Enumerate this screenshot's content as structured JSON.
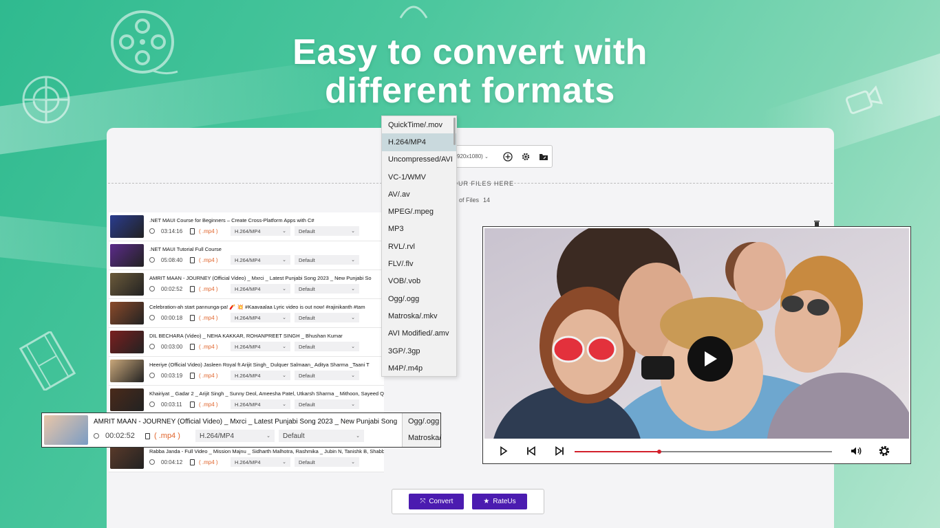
{
  "headline": {
    "line1": "Easy to convert with",
    "line2": "different formats"
  },
  "toolbar": {
    "resolution_label": "920x1080)",
    "add_icon": "plus-circle-icon",
    "settings_icon": "gear-icon",
    "folder_icon": "folder-icon"
  },
  "dropzone": {
    "label": "OUR FILES HERE",
    "files_label": "of Files",
    "files_count": "14"
  },
  "files": [
    {
      "title": ".NET MAUI Course for Beginners – Create Cross-Platform Apps with C#",
      "duration": "03:14:16",
      "ext": "( .mp4 )",
      "format": "H.264/MP4",
      "preset": "Default",
      "thumb_color": "#2a3c8f"
    },
    {
      "title": ".NET MAUI Tutorial Full Course",
      "duration": "05:08:40",
      "ext": "( .mp4 )",
      "format": "H.264/MP4",
      "preset": "Default",
      "thumb_color": "#5b2b8a"
    },
    {
      "title": "AMRIT MAAN - JOURNEY (Official Video) _ Mxrci _ Latest Punjabi Song 2023 _ New Punjabi So",
      "duration": "00:02:52",
      "ext": "( .mp4 )",
      "format": "H.264/MP4",
      "preset": "Default",
      "thumb_color": "#6b5a3a"
    },
    {
      "title": "Celebration-ah start pannunga-pa! 🧨 💥 #Kaavaalaa Lyric video is out now! #rajinikanth #tam",
      "duration": "00:00:18",
      "ext": "( .mp4 )",
      "format": "H.264/MP4",
      "preset": "Default",
      "thumb_color": "#8a4a2a"
    },
    {
      "title": "DIL BECHARA (Video) _ NEHA KAKKAR, ROHANPREET SINGH _ Bhushan Kumar",
      "duration": "00:03:00",
      "ext": "( .mp4 )",
      "format": "H.264/MP4",
      "preset": "Default",
      "thumb_color": "#7a1f1f"
    },
    {
      "title": "Heeriye (Official Video) Jasleen Royal ft Arijit Singh_ Dulquer Salmaan_ Aditya Sharma _Taani T",
      "duration": "00:03:19",
      "ext": "( .mp4 )",
      "format": "H.264/MP4",
      "preset": "Default",
      "thumb_color": "#c9a77a"
    },
    {
      "title": "Khairiyat _ Gadar 2 _ Arijit Singh _ Sunny Deol, Ameesha Patel, Utkarsh Sharma _ Mithoon, Sayeed Q",
      "duration": "00:03:11",
      "ext": "( .mp4 )",
      "format": "H.264/MP4",
      "preset": "Default",
      "thumb_color": "#4a2a1a"
    },
    {
      "title": "",
      "duration": "",
      "ext": "",
      "format": "",
      "preset": "",
      "thumb_color": "#888"
    },
    {
      "title": "Rabba Janda - Full Video _ Mission Majnu _ Sidharth Malhotra, Rashmika _ Jubin N, Tanishk B, Shabbir",
      "duration": "00:04:12",
      "ext": "( .mp4 )",
      "format": "H.264/MP4",
      "preset": "Default",
      "thumb_color": "#5a3a2a"
    }
  ],
  "formats": [
    "QuickTime/.mov",
    "H.264/MP4",
    "Uncompressed/AVI",
    "VC-1/WMV",
    "AV/.av",
    "MPEG/.mpeg",
    "MP3",
    "RVL/.rvl",
    "FLV/.flv",
    "VOB/.vob",
    "Ogg/.ogg",
    "Matroska/.mkv",
    "AVI Modified/.amv",
    "3GP/.3gp",
    "M4P/.m4p"
  ],
  "zoomed": {
    "title": "AMRIT MAAN - JOURNEY (Official Video) _ Mxrci _ Latest Punjabi Song 2023 _ New Punjabi Song",
    "duration": "00:02:52",
    "ext": "( .mp4 )",
    "format": "H.264/MP4",
    "preset": "Default",
    "dd_item1": "Ogg/.ogg",
    "dd_item2": "Matroska/"
  },
  "buttons": {
    "convert": "Convert",
    "rate": "RateUs"
  },
  "player": {
    "progress": 0.33
  }
}
